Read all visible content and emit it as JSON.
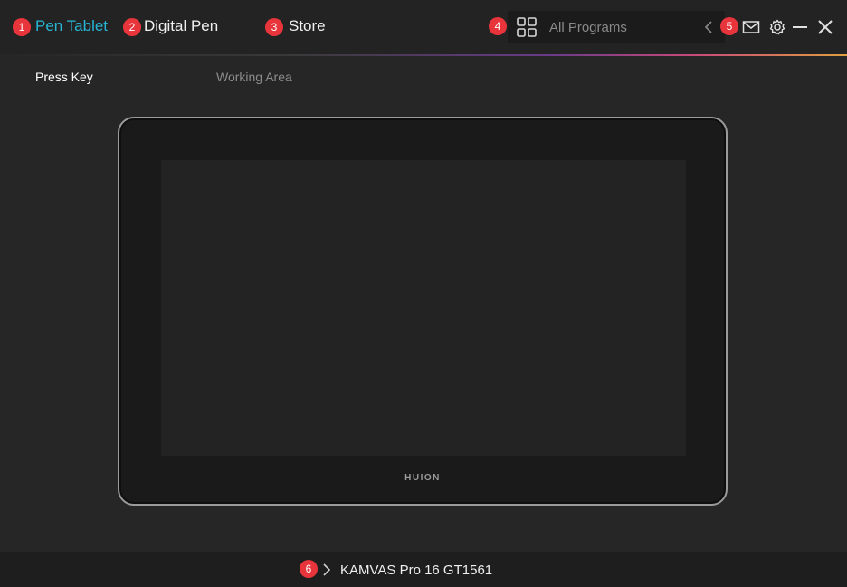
{
  "header": {
    "tabs": [
      {
        "badge": "1",
        "label": "Pen Tablet"
      },
      {
        "badge": "2",
        "label": "Digital Pen"
      },
      {
        "badge": "3",
        "label": "Store"
      }
    ],
    "program_badge": "4",
    "program_label": "All Programs",
    "window_badge": "5",
    "active_color": "#27b5d6"
  },
  "subtabs": [
    {
      "label": "Press Key"
    },
    {
      "label": "Working Area"
    }
  ],
  "tablet": {
    "brand": "HUION"
  },
  "footer": {
    "badge": "6",
    "device_name": "KAMVAS Pro 16 GT1561"
  },
  "icons": [
    "grid-icon",
    "chevron-left-icon",
    "mail-icon",
    "gear-icon",
    "minimize-icon",
    "close-icon",
    "chevron-right-icon"
  ]
}
